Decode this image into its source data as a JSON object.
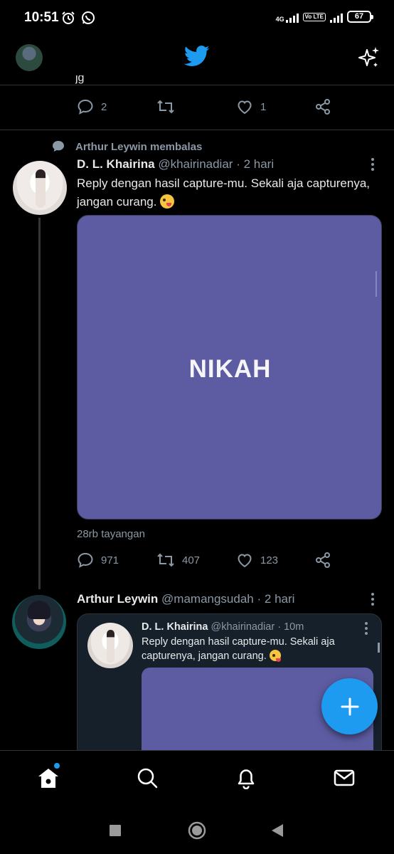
{
  "status_bar": {
    "time": "10:51",
    "network": "4G",
    "volte": "Vo LTE",
    "battery": "67"
  },
  "header": {
    "logo_icon": "twitter-bird-icon",
    "sparkle_icon": "sparkle-icon",
    "partial_text": "jg"
  },
  "top_tweet_actions": {
    "reply_count": "2",
    "retweet_count": "",
    "like_count": "1"
  },
  "main_tweet": {
    "social_context": "Arthur Leywin membalas",
    "author_name": "D. L. Khairina",
    "author_handle": "@khairinadiar",
    "separator": "·",
    "time": "2 hari",
    "text": "Reply dengan hasil capture-mu. Sekali aja capturenya, jangan curang.",
    "emoji": "zany-face-emoji",
    "media_text": "NIKAH",
    "media_color": "#5d5ca2",
    "views": "28rb tayangan",
    "reply_count": "971",
    "retweet_count": "407",
    "like_count": "123"
  },
  "reply_tweet": {
    "author_name": "Arthur Leywin",
    "author_handle": "@mamangsudah",
    "separator": "·",
    "time": "2 hari",
    "quote": {
      "author_name": "D. L. Khairina",
      "author_handle": "@khairinadiar",
      "separator": "·",
      "time": "10m",
      "text": "Reply dengan hasil capture-mu. Sekali aja capturenya, jangan curang."
    }
  },
  "colors": {
    "accent": "#1d9bf0",
    "background": "#000000",
    "muted_text": "#8b98a5",
    "quote_bg": "#15202b"
  },
  "tabs": [
    {
      "icon": "home-icon",
      "active": true
    },
    {
      "icon": "search-icon"
    },
    {
      "icon": "bell-icon"
    },
    {
      "icon": "mail-icon"
    }
  ]
}
